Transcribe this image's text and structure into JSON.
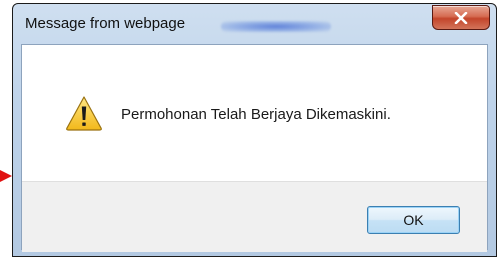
{
  "dialog": {
    "title": "Message from webpage",
    "message": "Permohonan Telah Berjaya Dikemaskini.",
    "ok_label": "OK",
    "icon": "warning-icon",
    "close_icon": "close-icon"
  },
  "colors": {
    "title_bar": "#bed3ea",
    "close_button": "#c3452b",
    "button_area": "#f0f0f0",
    "ok_border": "#3c7fb1",
    "pointer_arrow": "#e01010"
  }
}
